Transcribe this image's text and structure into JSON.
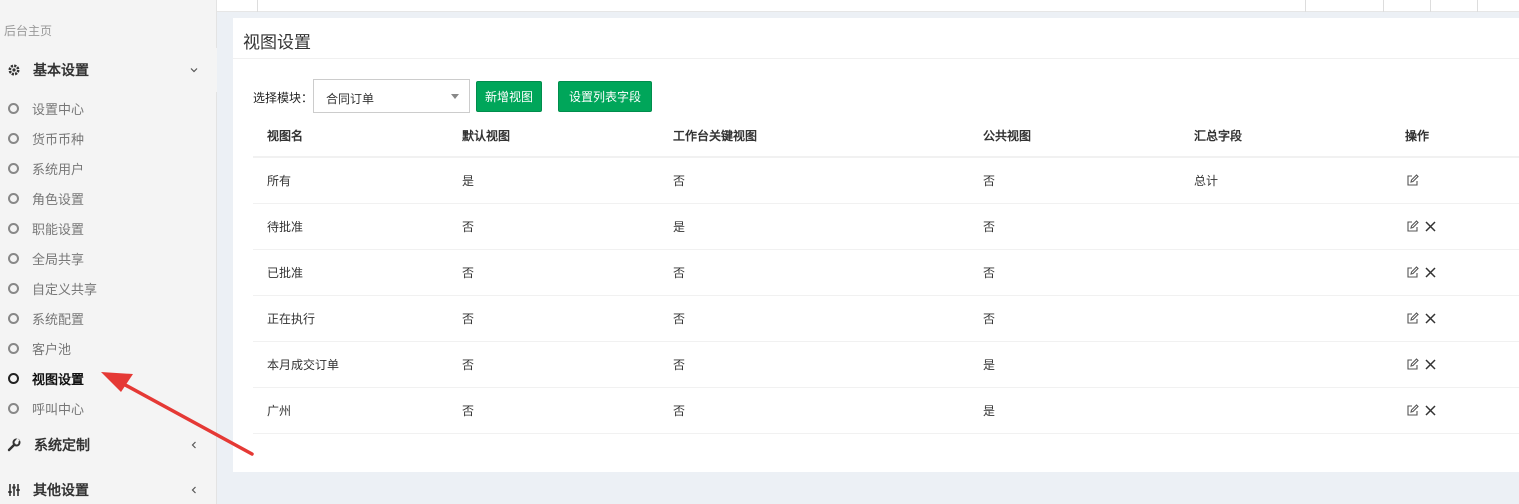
{
  "sidebar": {
    "home": "后台主页",
    "groups": {
      "basic": {
        "label": "基本设置",
        "icon": "gear-icon",
        "expanded": true
      },
      "custom": {
        "label": "系统定制",
        "icon": "wrench-icon",
        "expanded": false
      },
      "other": {
        "label": "其他设置",
        "icon": "sliders-icon",
        "expanded": false
      }
    },
    "items": [
      {
        "label": "设置中心",
        "active": false
      },
      {
        "label": "货币币种",
        "active": false
      },
      {
        "label": "系统用户",
        "active": false
      },
      {
        "label": "角色设置",
        "active": false
      },
      {
        "label": "职能设置",
        "active": false
      },
      {
        "label": "全局共享",
        "active": false
      },
      {
        "label": "自定义共享",
        "active": false
      },
      {
        "label": "系统配置",
        "active": false
      },
      {
        "label": "客户池",
        "active": false
      },
      {
        "label": "视图设置",
        "active": true
      },
      {
        "label": "呼叫中心",
        "active": false
      }
    ]
  },
  "main": {
    "title": "视图设置",
    "select_label": "选择模块：",
    "select_value": "合同订单",
    "add_button": "新增视图",
    "fields_button": "设置列表字段",
    "table": {
      "headers": [
        "视图名",
        "默认视图",
        "工作台关键视图",
        "公共视图",
        "汇总字段",
        "操作"
      ],
      "rows": [
        {
          "name": "所有",
          "default": "是",
          "workbench": "否",
          "public": "否",
          "summary": "总计",
          "deletable": false
        },
        {
          "name": "待批准",
          "default": "否",
          "workbench": "是",
          "public": "否",
          "summary": "",
          "deletable": true
        },
        {
          "name": "已批准",
          "default": "否",
          "workbench": "否",
          "public": "否",
          "summary": "",
          "deletable": true
        },
        {
          "name": "正在执行",
          "default": "否",
          "workbench": "否",
          "public": "否",
          "summary": "",
          "deletable": true
        },
        {
          "name": "本月成交订单",
          "default": "否",
          "workbench": "否",
          "public": "是",
          "summary": "",
          "deletable": true
        },
        {
          "name": "广州",
          "default": "否",
          "workbench": "否",
          "public": "是",
          "summary": "",
          "deletable": true
        }
      ]
    }
  },
  "colors": {
    "accent_green": "#00a65a",
    "annotation_red": "#e53935",
    "sidebar_bg": "#f4f4f4",
    "page_bg": "#ecf0f5"
  }
}
